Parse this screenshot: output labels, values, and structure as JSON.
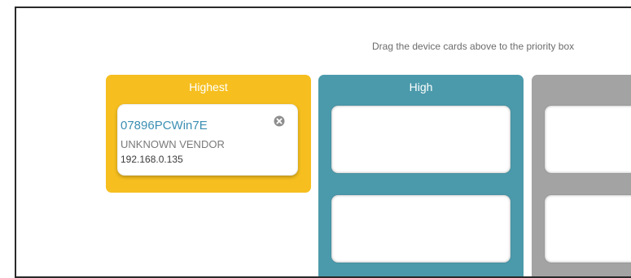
{
  "hint": {
    "text": "Drag the device cards above to the priority box"
  },
  "columns": [
    {
      "title": "Highest",
      "color": "#f6bf1f"
    },
    {
      "title": "High",
      "color": "#4b9aab"
    },
    {
      "title": "",
      "color": "#a3a3a3"
    }
  ],
  "device_card": {
    "name": "07896PCWin7E",
    "vendor": "UNKNOWN VENDOR",
    "ip": "192.168.0.135",
    "remove_icon": "close-icon"
  }
}
